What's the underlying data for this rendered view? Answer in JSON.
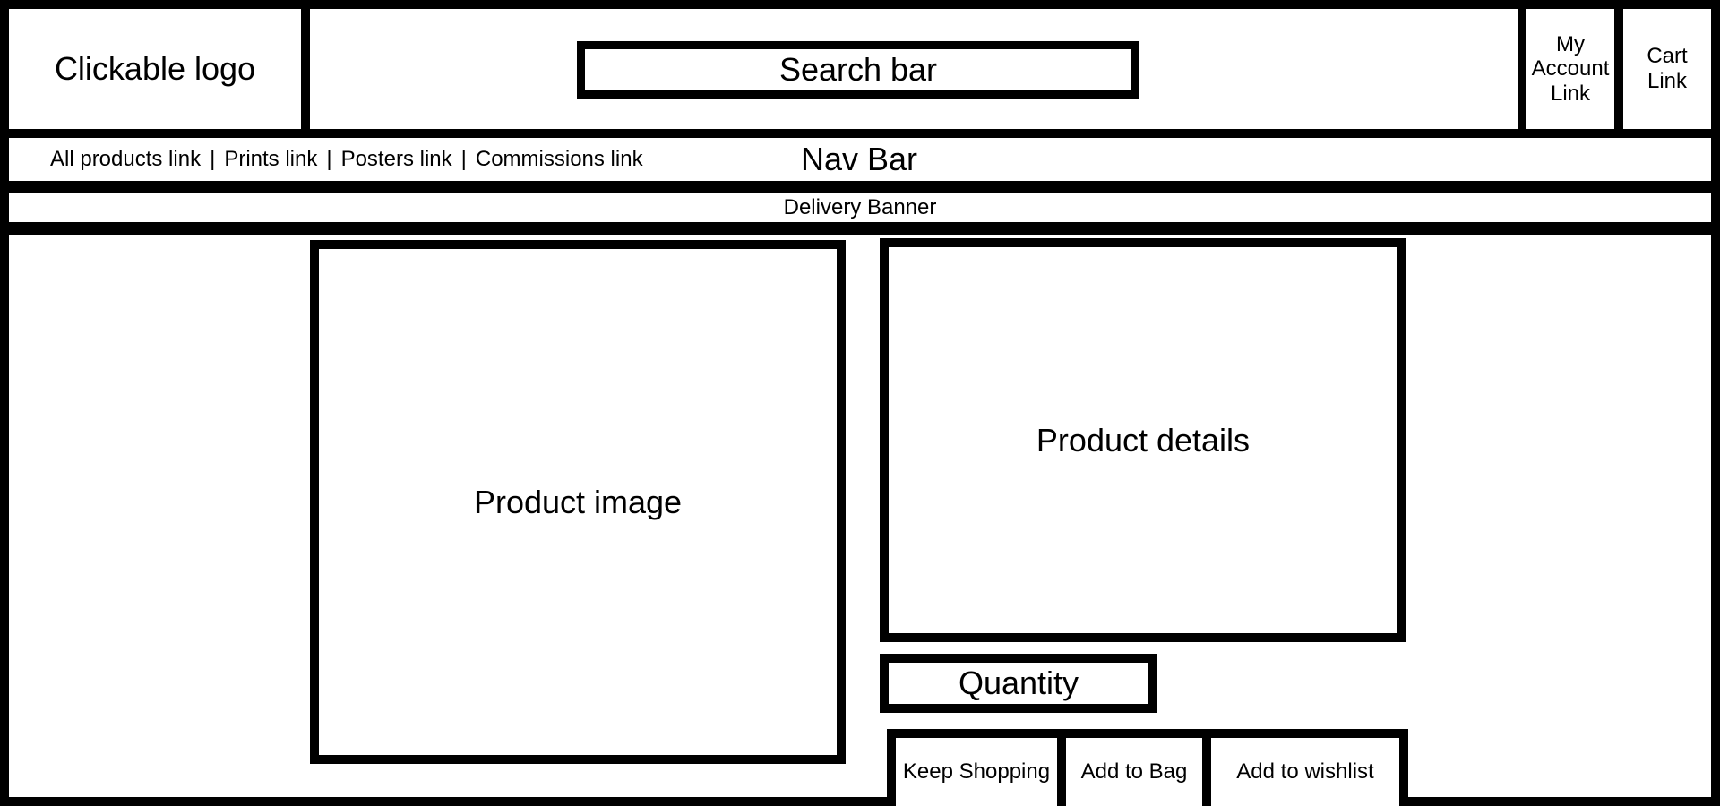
{
  "header": {
    "logo_label": "Clickable logo",
    "search_label": "Search bar",
    "account_label": "My\nAccount\nLink",
    "cart_label": "Cart\nLink"
  },
  "nav": {
    "title": "Nav Bar",
    "links": [
      "All products link",
      "Prints link",
      "Posters link",
      "Commissions link"
    ],
    "separator": "|"
  },
  "banner": {
    "label": "Delivery Banner"
  },
  "product": {
    "image_label": "Product image",
    "details_label": "Product details",
    "quantity_label": "Quantity",
    "buttons": {
      "keep_shopping": "Keep Shopping",
      "add_to_bag": "Add to Bag",
      "add_to_wishlist": "Add to wishlist"
    }
  },
  "colors": {
    "stroke": "#000000",
    "background": "#ffffff"
  }
}
